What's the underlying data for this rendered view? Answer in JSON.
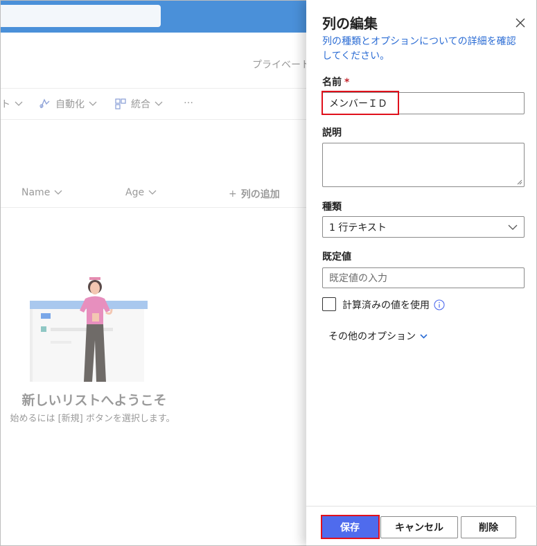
{
  "background": {
    "privacy_text": "プライベート",
    "commands": [
      {
        "label": "ト",
        "icon": "chevron-down-icon"
      },
      {
        "label": "自動化",
        "icon": "automate-icon"
      },
      {
        "label": "統合",
        "icon": "integrate-icon"
      },
      {
        "label": "…",
        "icon": "more-icon"
      }
    ],
    "columns": {
      "name": "Name",
      "age": "Age",
      "add_column": "列の追加"
    },
    "welcome_title": "新しいリストへようこそ",
    "welcome_subtitle": "始めるには [新規] ボタンを選択します。"
  },
  "panel": {
    "title": "列の編集",
    "help_link": "列の種類とオプションについての詳細を確認してください。",
    "name_label": "名前",
    "name_required_mark": "*",
    "name_value": "メンバーＩＤ",
    "description_label": "説明",
    "type_label": "種類",
    "type_value": "1 行テキスト",
    "default_label": "既定値",
    "default_placeholder": "既定値の入力",
    "calculated_label": "計算済みの値を使用",
    "more_options": "その他のオプション",
    "save_label": "保存",
    "cancel_label": "キャンセル",
    "delete_label": "削除"
  },
  "colors": {
    "accent": "#4f6bed",
    "topbar": "#4a90d9",
    "link": "#2b6cd4",
    "highlight": "#e0101b"
  }
}
